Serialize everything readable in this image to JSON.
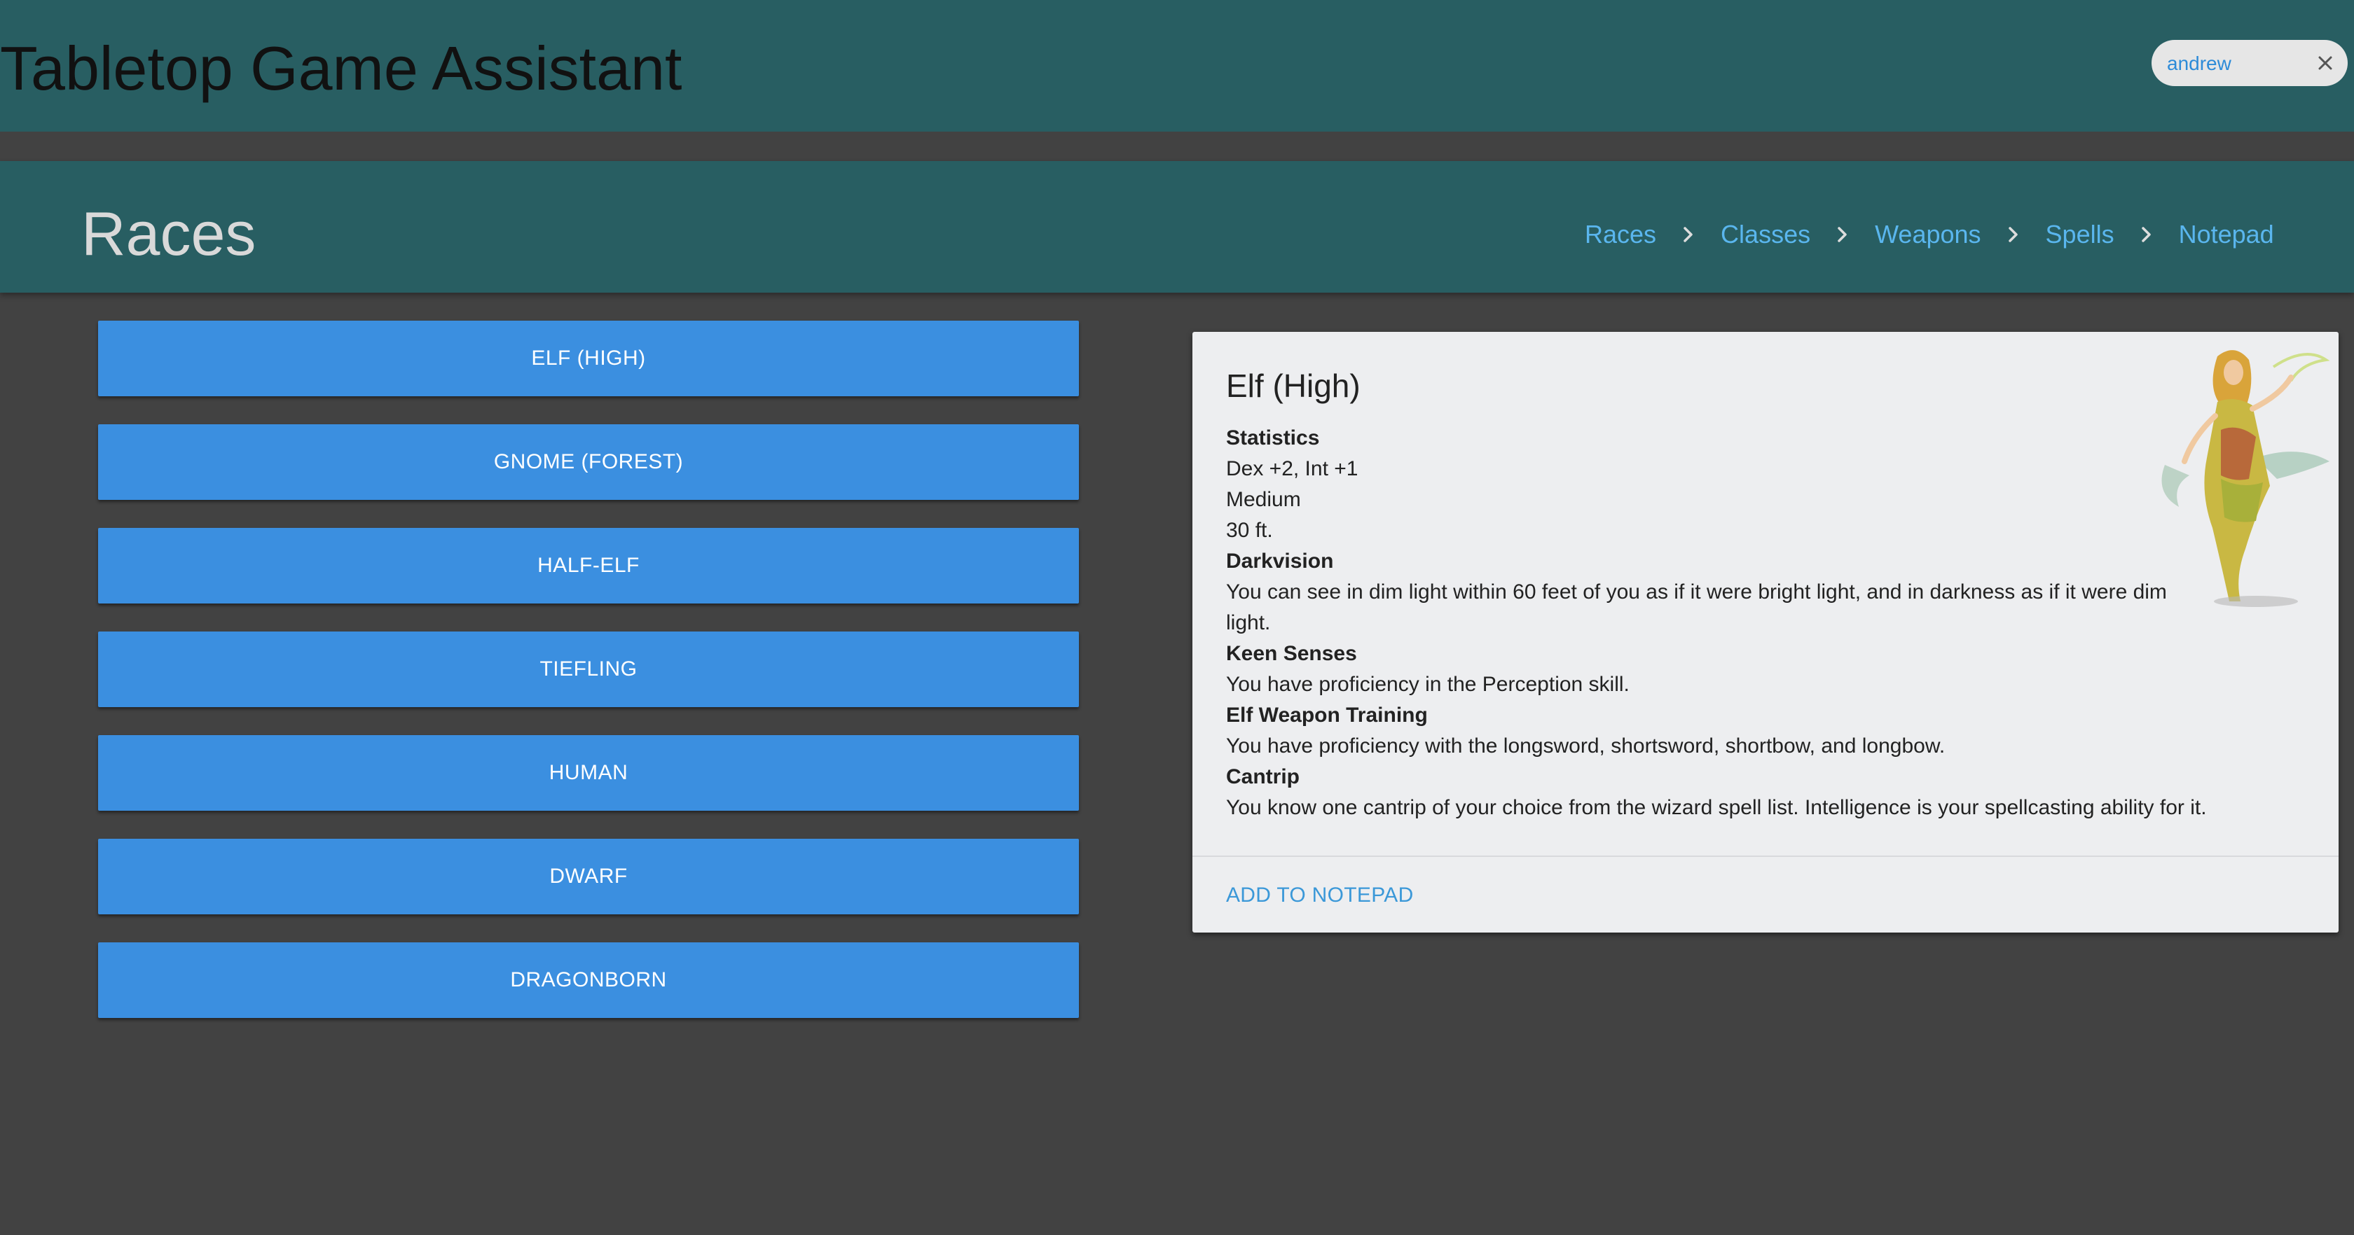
{
  "app": {
    "title": "Tabletop Game Assistant",
    "user_chip": {
      "label": "andrew",
      "close_icon": "close-icon"
    }
  },
  "section": {
    "title": "Races",
    "breadcrumb": [
      {
        "label": "Races"
      },
      {
        "label": "Classes"
      },
      {
        "label": "Weapons"
      },
      {
        "label": "Spells"
      },
      {
        "label": "Notepad"
      }
    ],
    "separator_icon": "chevron-right-icon"
  },
  "races": [
    {
      "label": "ELF (HIGH)"
    },
    {
      "label": "GNOME (FOREST)"
    },
    {
      "label": "HALF-ELF"
    },
    {
      "label": "TIEFLING"
    },
    {
      "label": "HUMAN"
    },
    {
      "label": "DWARF"
    },
    {
      "label": "DRAGONBORN"
    }
  ],
  "detail": {
    "title": "Elf (High)",
    "statistics_heading": "Statistics",
    "stat_bonus": "Dex +2, Int +1",
    "size": "Medium",
    "speed": "30 ft.",
    "features": [
      {
        "name": "Darkvision",
        "text": "You can see in dim light within 60 feet of you as if it were bright light, and in darkness as if it were dim light."
      },
      {
        "name": "Keen Senses",
        "text": "You have proficiency in the Perception skill."
      },
      {
        "name": "Elf Weapon Training",
        "text": "You have proficiency with the longsword, shortsword, shortbow, and longbow."
      },
      {
        "name": "Cantrip",
        "text": "You know one cantrip of your choice from the wizard spell list. Intelligence is your spellcasting ability for it."
      }
    ],
    "action_label": "ADD TO NOTEPAD",
    "image_icon": "elf-illustration"
  },
  "colors": {
    "app_bar": "#285e62",
    "background": "#424242",
    "button": "#3b8fe0",
    "link": "#5ab6ee",
    "card": "#edeef0"
  }
}
